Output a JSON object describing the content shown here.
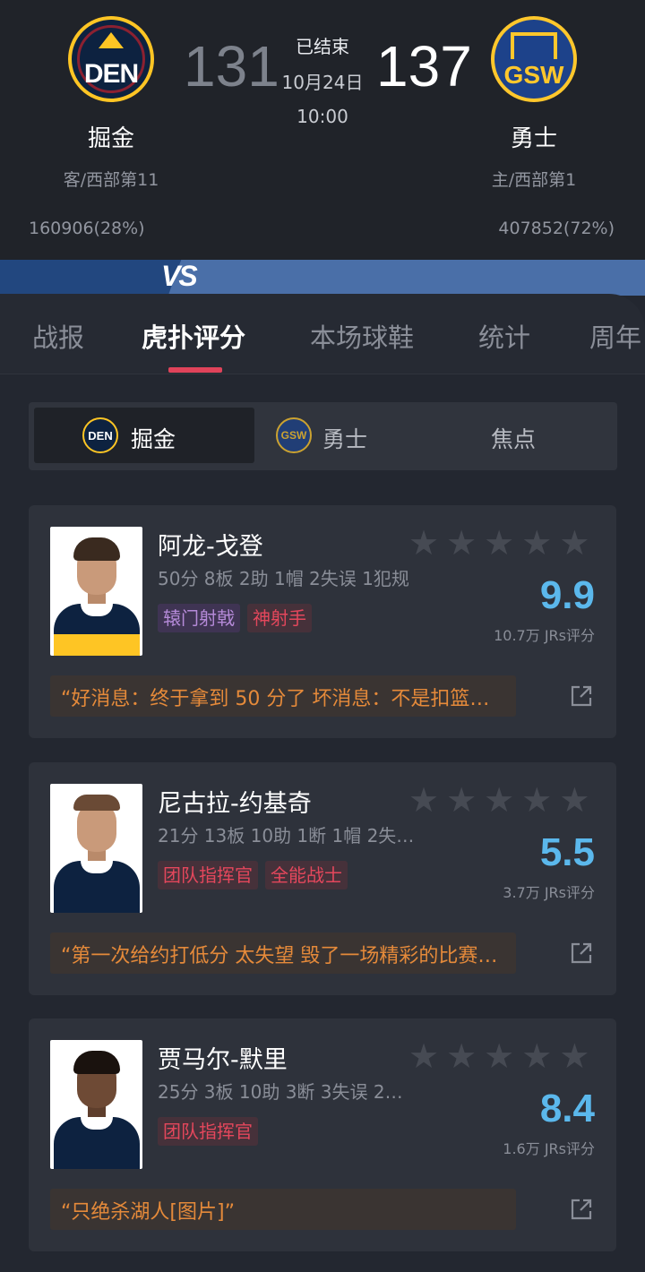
{
  "game": {
    "status": "已结束",
    "date": "10月24日",
    "time": "10:00",
    "away": {
      "name": "掘金",
      "abbr": "DEN",
      "score": "131",
      "rank": "客/西部第11",
      "votes": "160906(28%)",
      "color": "#0d2240",
      "accent": "#fec524"
    },
    "home": {
      "name": "勇士",
      "abbr": "GSW",
      "score": "137",
      "rank": "主/西部第1",
      "votes": "407852(72%)",
      "color": "#1d428a",
      "accent": "#ffc72c"
    },
    "vs_label": "VS"
  },
  "tabs": [
    {
      "label": "战报",
      "active": false
    },
    {
      "label": "虎扑评分",
      "active": true
    },
    {
      "label": "本场球鞋",
      "active": false
    },
    {
      "label": "统计",
      "active": false
    },
    {
      "label": "周年",
      "active": false
    }
  ],
  "team_filter": [
    {
      "label": "掘金",
      "logo": "DEN",
      "active": true
    },
    {
      "label": "勇士",
      "logo": "GSW",
      "active": false
    },
    {
      "label": "焦点",
      "active": false
    }
  ],
  "players": [
    {
      "name": "阿龙-戈登",
      "stats": "50分 8板 2助 1帽 2失误 1犯规",
      "tags": [
        {
          "text": "辕门射戟",
          "style": "purple"
        },
        {
          "text": "神射手",
          "style": "red"
        }
      ],
      "rating": "9.9",
      "raters": "10.7万 JRs评分",
      "quote": "“好消息：终于拿到 50 分了 坏消息：不是扣篮…",
      "stars_filled": 0
    },
    {
      "name": "尼古拉-约基奇",
      "stats": "21分 13板 10助 1断 1帽 2失…",
      "tags": [
        {
          "text": "团队指挥官",
          "style": "red"
        },
        {
          "text": "全能战士",
          "style": "red"
        }
      ],
      "rating": "5.5",
      "raters": "3.7万 JRs评分",
      "quote": "“第一次给约打低分 太失望 毁了一场精彩的比赛…",
      "stars_filled": 0
    },
    {
      "name": "贾马尔-默里",
      "stats": "25分 3板 10助 3断 3失误 2…",
      "tags": [
        {
          "text": "团队指挥官",
          "style": "red"
        }
      ],
      "rating": "8.4",
      "raters": "1.6万 JRs评分",
      "quote": "“只绝杀湖人[图片]”",
      "stars_filled": 0
    }
  ],
  "colors": {
    "background": "#232730",
    "card": "#2e323b",
    "rating": "#5bb8ec",
    "tab_indicator": "#e0435a",
    "quote_text": "#e58a3a"
  }
}
